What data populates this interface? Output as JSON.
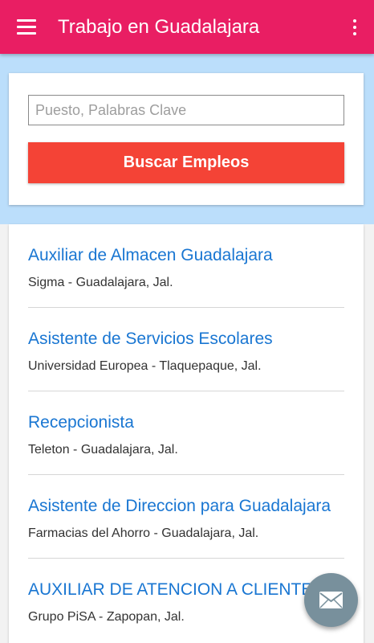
{
  "app_bar": {
    "title": "Trabajo en Guadalajara",
    "background_color": "#e91e63",
    "menu_icon": "hamburger-menu-icon",
    "overflow_icon": "more-vert-icon"
  },
  "search": {
    "placeholder": "Puesto, Palabras Clave",
    "value": "",
    "button_label": "Buscar Empleos",
    "button_color": "#f44336"
  },
  "jobs": [
    {
      "title": "Auxiliar de Almacen Guadalajara",
      "subtitle": "Sigma - Guadalajara, Jal."
    },
    {
      "title": "Asistente de Servicios Escolares",
      "subtitle": "Universidad Europea - Tlaquepaque, Jal."
    },
    {
      "title": "Recepcionista",
      "subtitle": "Teleton - Guadalajara, Jal."
    },
    {
      "title": "Asistente de Direccion para Guadalajara",
      "subtitle": "Farmacias del Ahorro - Guadalajara, Jal."
    },
    {
      "title": "AUXILIAR DE ATENCION A CLIENTE",
      "subtitle": "Grupo PiSA - Zapopan, Jal."
    }
  ],
  "fab": {
    "icon": "email-icon",
    "background_color": "#78909c"
  },
  "colors": {
    "job_title": "#1976d2",
    "band": "#bbdefb"
  }
}
